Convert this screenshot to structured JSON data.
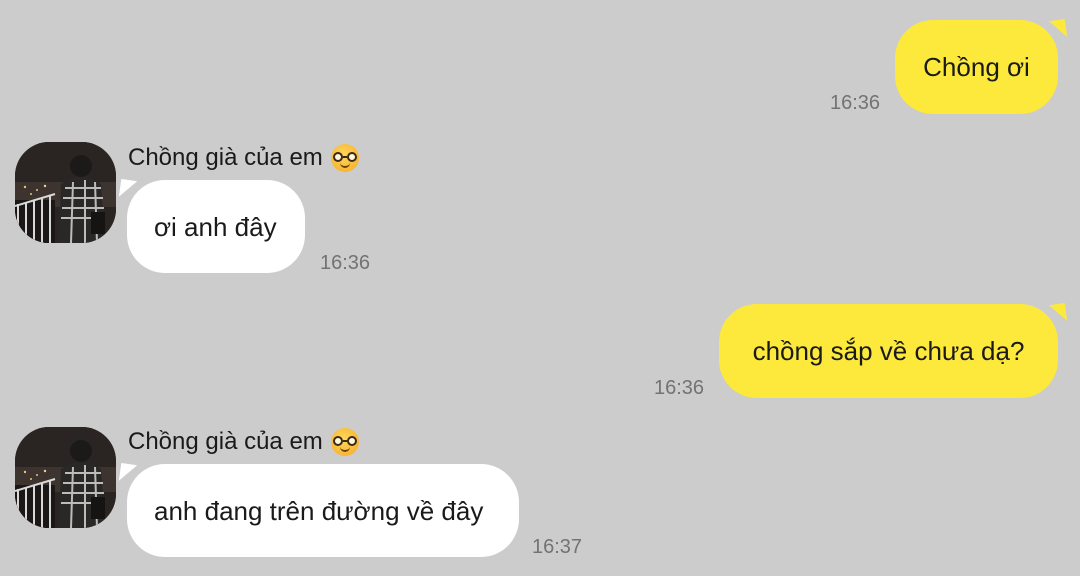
{
  "messages": [
    {
      "direction": "outgoing",
      "text": "Chồng ơi",
      "time": "16:36"
    },
    {
      "direction": "incoming",
      "sender": "Chồng già của em",
      "text": "ơi anh đây",
      "time": "16:36"
    },
    {
      "direction": "outgoing",
      "text": "chồng sắp về chưa dạ?",
      "time": "16:36"
    },
    {
      "direction": "incoming",
      "sender": "Chồng già của em",
      "text": "anh đang trên đường về đây",
      "time": "16:37"
    }
  ],
  "icons": {
    "sender_emoji": "nerd-face-emoji",
    "avatar": "avatar-photo"
  },
  "colors": {
    "background": "#cccccc",
    "outgoing_bubble": "#fde93b",
    "incoming_bubble": "#ffffff",
    "timestamp": "#737373"
  }
}
